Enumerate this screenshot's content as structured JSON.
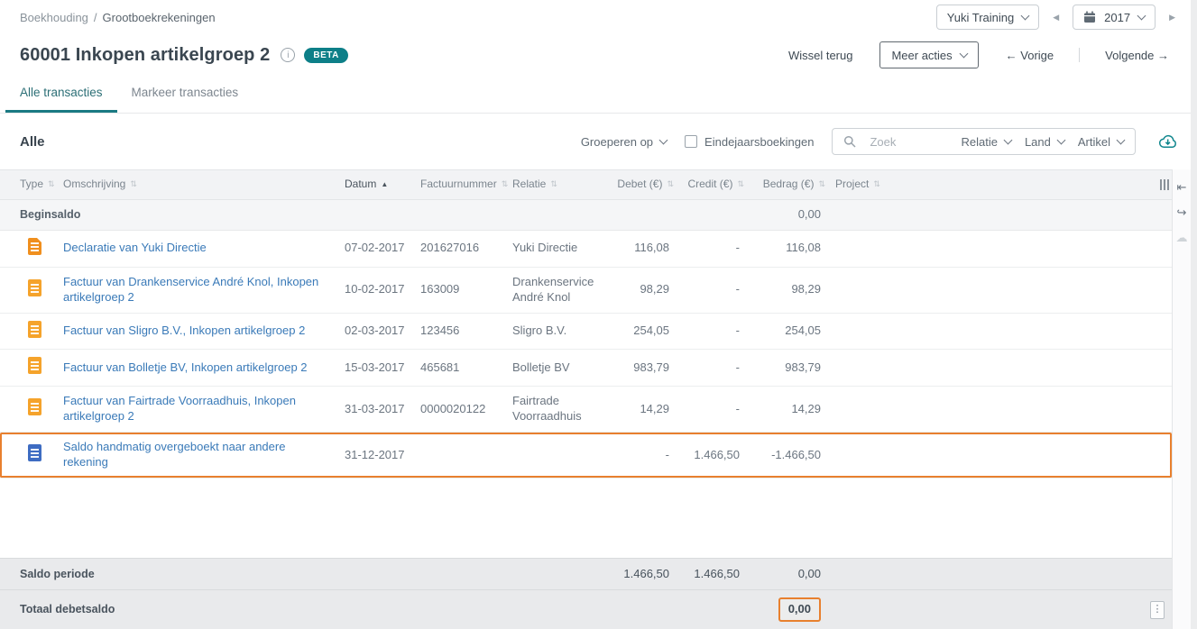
{
  "breadcrumb": {
    "section": "Boekhouding",
    "separator": "/",
    "page": "Grootboekrekeningen"
  },
  "topbar": {
    "administration": "Yuki Training",
    "year": "2017"
  },
  "header": {
    "title": "60001 Inkopen artikelgroep 2",
    "beta_badge": "BETA",
    "wissel_terug": "Wissel terug",
    "meer_acties": "Meer acties",
    "vorige": "← Vorige",
    "volgende": "Volgende →"
  },
  "tabs": {
    "alle": "Alle transacties",
    "markeer": "Markeer transacties"
  },
  "filterbar": {
    "title": "Alle",
    "groeperen_op": "Groeperen op",
    "eindejaarsboekingen": "Eindejaarsboekingen",
    "search_placeholder": "Zoek",
    "relatie": "Relatie",
    "land": "Land",
    "artikel": "Artikel"
  },
  "table": {
    "headers": {
      "type": "Type",
      "omschrijving": "Omschrijving",
      "datum": "Datum",
      "factuurnummer": "Factuurnummer",
      "relatie": "Relatie",
      "debet": "Debet (€)",
      "credit": "Credit (€)",
      "bedrag": "Bedrag (€)",
      "project": "Project"
    },
    "beginsaldo": {
      "label": "Beginsaldo",
      "bedrag": "0,00"
    },
    "rows": [
      {
        "icon": "pdf-document-icon",
        "omschrijving": "Declaratie van Yuki Directie",
        "datum": "07-02-2017",
        "factuurnummer": "201627016",
        "relatie": "Yuki Directie",
        "debet": "116,08",
        "credit": "-",
        "bedrag": "116,08",
        "project": ""
      },
      {
        "icon": "document-icon-orange",
        "omschrijving": "Factuur van Drankenservice André Knol, Inkopen artikelgroep 2",
        "datum": "10-02-2017",
        "factuurnummer": "163009",
        "relatie": "Drankenservice André Knol",
        "debet": "98,29",
        "credit": "-",
        "bedrag": "98,29",
        "project": ""
      },
      {
        "icon": "document-icon-orange",
        "omschrijving": "Factuur van Sligro B.V., Inkopen artikelgroep 2",
        "datum": "02-03-2017",
        "factuurnummer": "123456",
        "relatie": "Sligro B.V.",
        "debet": "254,05",
        "credit": "-",
        "bedrag": "254,05",
        "project": ""
      },
      {
        "icon": "document-icon-orange",
        "omschrijving": "Factuur van Bolletje BV, Inkopen artikelgroep 2",
        "datum": "15-03-2017",
        "factuurnummer": "465681",
        "relatie": "Bolletje BV",
        "debet": "983,79",
        "credit": "-",
        "bedrag": "983,79",
        "project": ""
      },
      {
        "icon": "document-icon-orange",
        "omschrijving": "Factuur van Fairtrade Voorraadhuis, Inkopen artikelgroep 2",
        "datum": "31-03-2017",
        "factuurnummer": "0000020122",
        "relatie": "Fairtrade Voorraadhuis",
        "debet": "14,29",
        "credit": "-",
        "bedrag": "14,29",
        "project": ""
      },
      {
        "icon": "document-icon-blue",
        "omschrijving": "Saldo handmatig overgeboekt naar andere rekening",
        "datum": "31-12-2017",
        "factuurnummer": "",
        "relatie": "",
        "debet": "-",
        "credit": "1.466,50",
        "bedrag": "-1.466,50",
        "project": "",
        "highlighted": true
      }
    ],
    "footer": {
      "saldo_periode": {
        "label": "Saldo periode",
        "debet": "1.466,50",
        "credit": "1.466,50",
        "bedrag": "0,00"
      },
      "totaal_debetsaldo": {
        "label": "Totaal debetsaldo",
        "bedrag": "0,00"
      }
    }
  },
  "icons": {
    "prev": "◀",
    "next": "▶",
    "sort": "⇅",
    "sort_asc": "▲",
    "info": "i",
    "collapse": "⇤",
    "redo": "↪",
    "cloud": "☁",
    "kebab": "⋮"
  },
  "colors": {
    "accent_teal": "#0d7f88",
    "link_blue": "#3a7ab8",
    "highlight_orange": "#e8802e",
    "doc_orange": "#f5a32b",
    "doc_blue": "#3e6cc2",
    "footer_gray": "#e9eaec"
  }
}
